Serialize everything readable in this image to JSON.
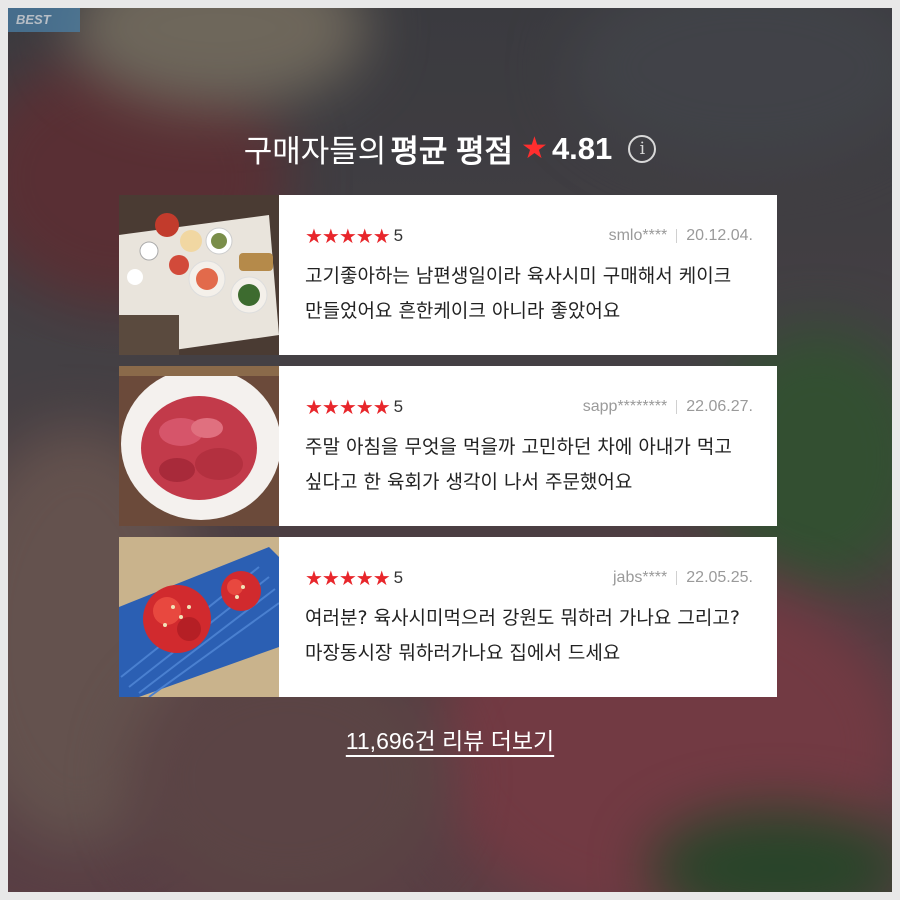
{
  "badge": "BEST",
  "header": {
    "prefix": "구매자들의",
    "bold": "평균 평점",
    "star": "★",
    "score": "4.81",
    "info_icon": "info-circle-icon"
  },
  "reviews": [
    {
      "stars": "★★★★★",
      "rating": "5",
      "user": "smlo****",
      "date": "20.12.04.",
      "text": "고기좋아하는 남편생일이라 육사시미 구매해서 케이크 만들었어요 흔한케이크 아니라 좋았어요",
      "thumb": "party-table-photo"
    },
    {
      "stars": "★★★★★",
      "rating": "5",
      "user": "sapp********",
      "date": "22.06.27.",
      "text": "주말 아침을 무엇을 먹을까 고민하던 차에 아내가 먹고 싶다고 한 육회가 생각이 나서 주문했어요",
      "thumb": "raw-beef-bowl-photo"
    },
    {
      "stars": "★★★★★",
      "rating": "5",
      "user": "jabs****",
      "date": "22.05.25.",
      "text": "여러분? 육사시미먹으러 강원도 뭐하러 가나요 그리고? 마장동시장 뭐하러가나요 집에서 드세요",
      "thumb": "yukhoe-plate-photo"
    }
  ],
  "more_link": "11,696건 리뷰 더보기",
  "colors": {
    "star": "#e8262b",
    "header_star": "#ff2e2e",
    "card_bg": "#ffffff"
  }
}
